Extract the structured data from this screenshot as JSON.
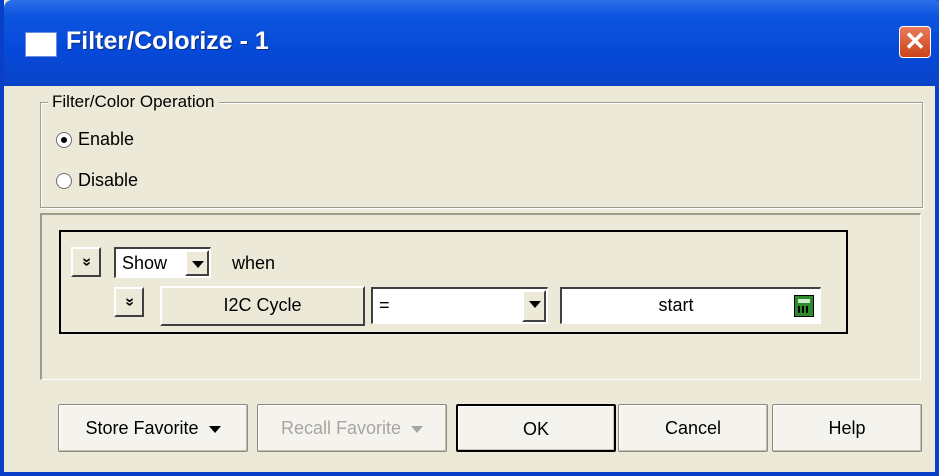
{
  "window": {
    "title": "Filter/Colorize - 1",
    "close_glyph": "✕"
  },
  "operation": {
    "legend": "Filter/Color Operation",
    "options": [
      {
        "label": "Enable",
        "checked": true
      },
      {
        "label": "Disable",
        "checked": false
      }
    ]
  },
  "rule": {
    "expand_glyph": "»",
    "action_value": "Show",
    "when_label": "when",
    "field_button": "I2C Cycle",
    "operator_value": "=",
    "value_text": "start",
    "calc_icon": "calculator-icon"
  },
  "buttons": {
    "store_favorite": "Store Favorite",
    "recall_favorite": "Recall Favorite",
    "ok": "OK",
    "cancel": "Cancel",
    "help": "Help"
  }
}
